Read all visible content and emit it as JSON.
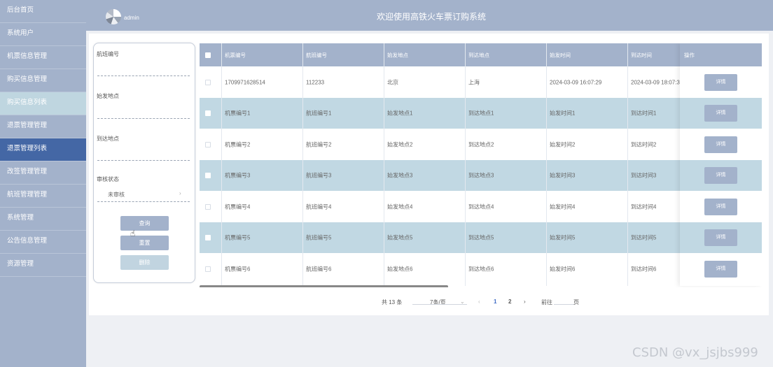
{
  "sidebar": {
    "items": [
      {
        "label": "后台首页"
      },
      {
        "label": "系统用户"
      },
      {
        "label": "机票信息管理"
      },
      {
        "label": "购买信息管理"
      },
      {
        "label": "购买信息列表"
      },
      {
        "label": "退票管理管理"
      },
      {
        "label": "退票管理列表"
      },
      {
        "label": "改签管理管理"
      },
      {
        "label": "航班管理管理"
      },
      {
        "label": "系统管理"
      },
      {
        "label": "公告信息管理"
      },
      {
        "label": "资源管理"
      }
    ]
  },
  "header": {
    "user": "admin",
    "title": "欢迎使用高铁火车票订购系统"
  },
  "search": {
    "flight_label": "航班编号",
    "origin_label": "始发地点",
    "dest_label": "到达地点",
    "status_label": "审核状态",
    "status_value": "未审核",
    "query_btn": "查询",
    "reset_btn": "重置",
    "delete_btn": "删除"
  },
  "table": {
    "headers": [
      "机票编号",
      "航班编号",
      "始发地点",
      "到达地点",
      "始发时间",
      "到达时间",
      "操作"
    ],
    "detail_label": "详情",
    "rows": [
      [
        "1709971628514",
        "112233",
        "北京",
        "上海",
        "2024-03-09 16:07:29",
        "2024-03-09 18:07:3"
      ],
      [
        "机票编号1",
        "航班编号1",
        "始发地点1",
        "到达地点1",
        "始发时间1",
        "到达时间1"
      ],
      [
        "机票编号2",
        "航班编号2",
        "始发地点2",
        "到达地点2",
        "始发时间2",
        "到达时间2"
      ],
      [
        "机票编号3",
        "航班编号3",
        "始发地点3",
        "到达地点3",
        "始发时间3",
        "到达时间3"
      ],
      [
        "机票编号4",
        "航班编号4",
        "始发地点4",
        "到达地点4",
        "始发时间4",
        "到达时间4"
      ],
      [
        "机票编号5",
        "航班编号5",
        "始发地点5",
        "到达地点5",
        "始发时间5",
        "到达时间5"
      ],
      [
        "机票编号6",
        "航班编号6",
        "始发地点6",
        "到达地点6",
        "始发时间6",
        "到达时间6"
      ]
    ]
  },
  "pagination": {
    "total": "共 13 条",
    "page_size": "7条/页",
    "prev": "‹",
    "pages": [
      "1",
      "2"
    ],
    "next": "›",
    "goto": "前往",
    "page_unit": "页"
  },
  "watermark": "CSDN @vx_jsjbs999",
  "colors": {
    "sidebar": "#a3b2cb",
    "sidebar_highlight": "#bfd6e0",
    "sidebar_active": "#4467a5",
    "row_alt": "#c1d8e3",
    "page_active": "#3f6cc5"
  }
}
